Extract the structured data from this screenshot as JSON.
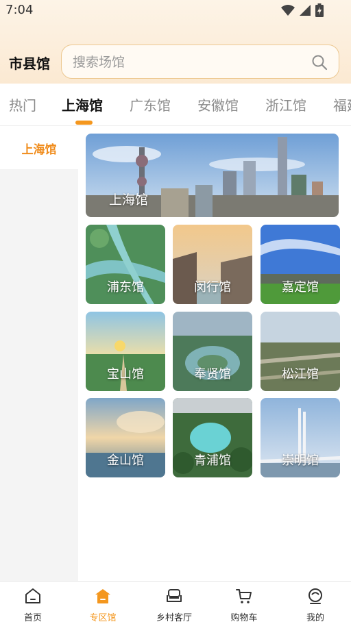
{
  "status_bar": {
    "time": "7:04"
  },
  "header": {
    "title": "市县馆",
    "search_placeholder": "搜索场馆"
  },
  "province_tabs": [
    {
      "label": "热门",
      "active": false
    },
    {
      "label": "上海馆",
      "active": true
    },
    {
      "label": "广东馆",
      "active": false
    },
    {
      "label": "安徽馆",
      "active": false
    },
    {
      "label": "浙江馆",
      "active": false
    },
    {
      "label": "福建",
      "active": false
    }
  ],
  "left_nav": {
    "items": [
      {
        "label": "上海馆",
        "active": true
      }
    ]
  },
  "main": {
    "banner": {
      "label": "上海馆"
    },
    "districts": [
      {
        "label": "浦东馆"
      },
      {
        "label": "闵行馆"
      },
      {
        "label": "嘉定馆"
      },
      {
        "label": "宝山馆"
      },
      {
        "label": "奉贤馆"
      },
      {
        "label": "松江馆"
      },
      {
        "label": "金山馆"
      },
      {
        "label": "青浦馆"
      },
      {
        "label": "崇明馆"
      }
    ]
  },
  "bottom_nav": [
    {
      "label": "首页",
      "icon": "home-icon",
      "active": false
    },
    {
      "label": "专区馆",
      "icon": "pavilion-icon",
      "active": true
    },
    {
      "label": "乡村客厅",
      "icon": "sofa-icon",
      "active": false
    },
    {
      "label": "购物车",
      "icon": "cart-icon",
      "active": false
    },
    {
      "label": "我的",
      "icon": "profile-icon",
      "active": false
    }
  ],
  "colors": {
    "accent": "#f4971e",
    "active_tab_text": "#111111",
    "inactive_tab_text": "#8a8a8a"
  }
}
